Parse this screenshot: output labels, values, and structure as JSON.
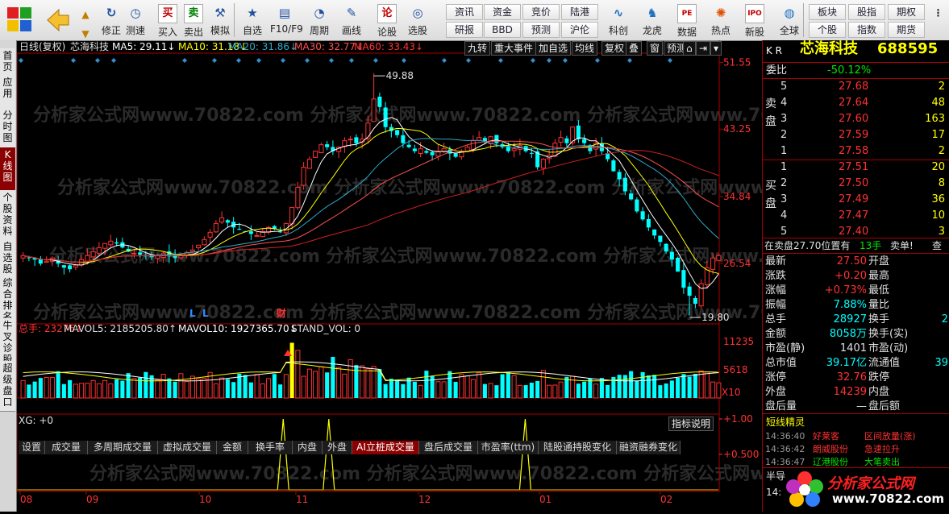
{
  "toolbar": {
    "groups_a": [
      {
        "label": "修正",
        "icon": "refresh-icon"
      },
      {
        "label": "测速",
        "icon": "clock-icon"
      },
      {
        "label": "买入",
        "icon": "buy-icon",
        "glyph": "买"
      },
      {
        "label": "卖出",
        "icon": "sell-icon",
        "glyph": "卖"
      },
      {
        "label": "模拟",
        "icon": "hammer-icon"
      },
      {
        "label": "自选",
        "icon": "star-icon"
      },
      {
        "label": "F10/F9",
        "icon": "f10-icon"
      },
      {
        "label": "周期",
        "icon": "period-clock-icon"
      },
      {
        "label": "画线",
        "icon": "pencil-icon"
      },
      {
        "label": "论股",
        "icon": "forum-icon",
        "glyph": "论"
      },
      {
        "label": "选股",
        "icon": "stock-picker-icon"
      }
    ],
    "grid_buttons": [
      "资讯",
      "资金",
      "竞价",
      "陆港",
      "研报",
      "BBD",
      "预测",
      "沪伦"
    ],
    "groups_b": [
      {
        "label": "科创",
        "icon": "kechuang-icon"
      },
      {
        "label": "龙虎",
        "icon": "dragon-tiger-icon"
      },
      {
        "label": "数据",
        "icon": "pe-icon",
        "glyph": "PE"
      },
      {
        "label": "热点",
        "icon": "hotspot-icon"
      },
      {
        "label": "新股",
        "icon": "ipo-icon",
        "glyph": "IPO"
      },
      {
        "label": "全球",
        "icon": "globe-icon"
      }
    ],
    "right_buttons": [
      "板块",
      "股指",
      "期权",
      "个股",
      "指数",
      "期货"
    ]
  },
  "left_tabs": [
    "首页",
    "应用",
    "分时图",
    "K线图",
    "个股资料",
    "自选股",
    "综合排名",
    "牛叉诊股",
    "超级盘口"
  ],
  "left_tab_active": 3,
  "chart_header": {
    "mode": "日线(复权)",
    "name": "芯海科技",
    "ma_items": [
      {
        "label": "MA5: 29.11↓",
        "color": "#ffffff"
      },
      {
        "label": "MA10: 31.18↓",
        "color": "#ffff00"
      },
      {
        "label": "MA20: 31.86↓",
        "color": "#30a8c8"
      },
      {
        "label": "MA30: 32.77↓",
        "color": "#ff5050"
      },
      {
        "label": "MA60: 33.43↓",
        "color": "#ff3232"
      }
    ],
    "buttons": [
      "九转",
      "重大事件",
      "加自选",
      "均线",
      "复权",
      "叠",
      "窗",
      "预测"
    ]
  },
  "price_axis": [
    "51.55",
    "43.25",
    "34.84",
    "26.54"
  ],
  "price_annotations": {
    "high": "49.88",
    "low": "19.80"
  },
  "event_marks": [
    "L",
    "L",
    "财"
  ],
  "volume_header": {
    "total": "总手: 23276↑",
    "mavol5": "MAVOL5: 2185205.80↑",
    "mavol10": "MAVOL10: 1927365.70↓",
    "std": "STAND_VOL: 0"
  },
  "volume_axis": [
    "11235",
    "5618",
    "X10"
  ],
  "indicator_tabs": [
    "设置",
    "成交量",
    "多周期成交量",
    "虚拟成交量",
    "金额",
    "换手率",
    "内盘",
    "外盘",
    "AI立桩成交量",
    "盘后成交量",
    "市盈率(ttm)",
    "陆股通持股变化",
    "融资融券变化"
  ],
  "indicator_tab_active": 8,
  "xg": {
    "label": "XG: +0",
    "help": "指标说明",
    "axis": [
      "+1.00",
      "+0.500"
    ]
  },
  "months": [
    "08",
    "09",
    "10",
    "11",
    "12",
    "01",
    "02"
  ],
  "watermark": "分析家公式网www.70822.com",
  "chart_data": {
    "type": "candlestick",
    "title": "芯海科技 日线(复权)",
    "ylim": [
      19.0,
      52.5
    ],
    "ma": {
      "MA5": 29.11,
      "MA10": 31.18,
      "MA20": 31.86,
      "MA30": 32.77,
      "MA60": 33.43
    },
    "high": 49.88,
    "low": 19.8,
    "volume_ylim": [
      0,
      11235
    ],
    "xg_signal_positions": [
      0.375,
      0.44,
      0.72
    ],
    "xg_ylim": [
      0,
      1
    ]
  },
  "quote": {
    "market": "K R",
    "name": "芯海科技",
    "code": "688595",
    "weibi_label": "委比",
    "weibi": "-50.12%",
    "sell_label": "卖盘",
    "buy_label": "买盘",
    "asks": [
      {
        "lvl": "5",
        "price": "27.68",
        "vol": "2"
      },
      {
        "lvl": "4",
        "price": "27.64",
        "vol": "48"
      },
      {
        "lvl": "3",
        "price": "27.60",
        "vol": "163"
      },
      {
        "lvl": "2",
        "price": "27.59",
        "vol": "17"
      },
      {
        "lvl": "1",
        "price": "27.58",
        "vol": "2"
      }
    ],
    "bids": [
      {
        "lvl": "1",
        "price": "27.51",
        "vol": "20"
      },
      {
        "lvl": "2",
        "price": "27.50",
        "vol": "8"
      },
      {
        "lvl": "3",
        "price": "27.49",
        "vol": "36"
      },
      {
        "lvl": "4",
        "price": "27.47",
        "vol": "10"
      },
      {
        "lvl": "5",
        "price": "27.40",
        "vol": "3"
      }
    ],
    "position_note": "在卖盘27.70位置有",
    "position_qty": "13手",
    "position_tag": "卖单!",
    "position_more": "查",
    "stats": [
      {
        "l": "最新",
        "v": "27.50",
        "c": "red",
        "r": "开盘"
      },
      {
        "l": "涨跌",
        "v": "+0.20",
        "c": "red",
        "r": "最高"
      },
      {
        "l": "涨幅",
        "v": "+0.73%",
        "c": "red",
        "r": "最低"
      },
      {
        "l": "振幅",
        "v": "7.88%",
        "c": "cyan",
        "r": "量比"
      },
      {
        "l": "总手",
        "v": "28927",
        "c": "cyan",
        "r": "换手"
      },
      {
        "l": "金额",
        "v": "8058万",
        "c": "cyan",
        "r": "换手(实)"
      },
      {
        "l": "市盈(静)",
        "v": "1401",
        "c": "wht",
        "r": "市盈(动)"
      },
      {
        "l": "总市值",
        "v": "39.17亿",
        "c": "cyan",
        "r": "流通值"
      },
      {
        "l": "涨停",
        "v": "32.76",
        "c": "red",
        "r": "跌停"
      },
      {
        "l": "外盘",
        "v": "14239",
        "c": "red",
        "r": "内盘"
      },
      {
        "l": "盘后量",
        "v": "—",
        "c": "wht",
        "r": "盘后额"
      }
    ],
    "stats_right_values": [
      "",
      "",
      "",
      "",
      "2",
      "",
      "",
      "39",
      "",
      "",
      ""
    ],
    "sprite_title": "短线精灵",
    "sprite_rows": [
      {
        "t": "14:36:40",
        "n": "好莱客",
        "e": "区间放量(涨)",
        "c": "red"
      },
      {
        "t": "14:36:42",
        "n": "朗威股份",
        "e": "急速拉升",
        "c": "red"
      },
      {
        "t": "14:36:47",
        "n": "辽港股份",
        "e": "大笔卖出",
        "c": "green"
      }
    ],
    "half_label": "半导",
    "bottom_time": "14:"
  },
  "logo": {
    "text": "分析家公式网",
    "url": "www.70822.com"
  }
}
